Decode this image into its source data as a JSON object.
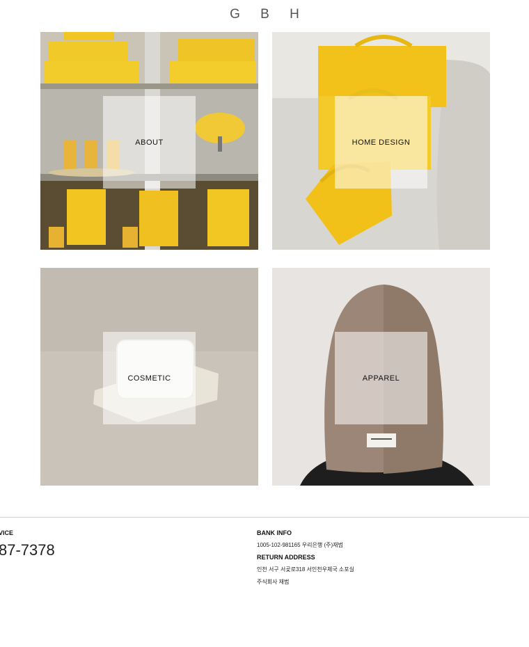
{
  "header": {
    "logo": "G B H"
  },
  "tiles": [
    {
      "label": "ABOUT"
    },
    {
      "label": "HOME DESIGN"
    },
    {
      "label": "COSMETIC"
    },
    {
      "label": "APPAREL"
    }
  ],
  "footer": {
    "cs_title": "VICE",
    "cs_phone": "87-7378",
    "bank_title": "BANK INFO",
    "bank_value": "1005-102-981165 우리은행 (주)재범",
    "return_title": "RETURN ADDRESS",
    "return_line1": "인천 서구 서곶로318 서인천우체국 소포실",
    "return_line2": "주식회사 재범"
  }
}
